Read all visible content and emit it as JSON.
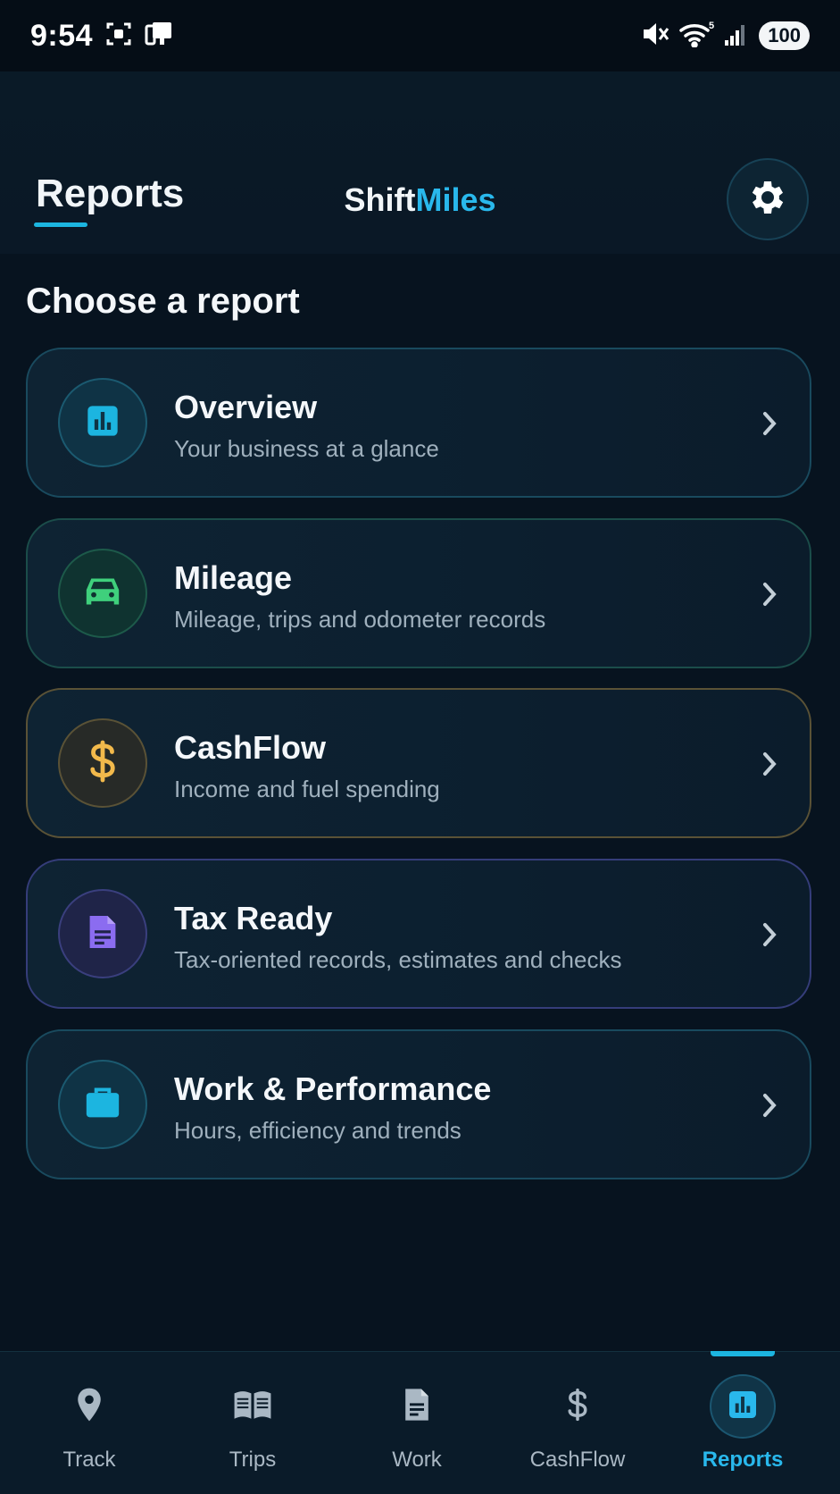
{
  "status_bar": {
    "time": "9:54",
    "battery": "100",
    "icons": [
      "screenshot-icon",
      "cast-icon",
      "mute-icon",
      "wifi-icon",
      "signal-icon"
    ]
  },
  "header": {
    "title": "Reports",
    "brand_part1": "Shift",
    "brand_part2": "Miles",
    "settings_icon": "gear-icon"
  },
  "main": {
    "section_title": "Choose a report",
    "reports": [
      {
        "title": "Overview",
        "subtitle": "Your business at a glance",
        "icon": "bar-chart-icon",
        "accent": "#1cb5e0"
      },
      {
        "title": "Mileage",
        "subtitle": "Mileage, trips and odometer records",
        "icon": "car-icon",
        "accent": "#3fd07c"
      },
      {
        "title": "CashFlow",
        "subtitle": "Income and fuel spending",
        "icon": "dollar-icon",
        "accent": "#f2b94b"
      },
      {
        "title": "Tax Ready",
        "subtitle": "Tax-oriented records, estimates and checks",
        "icon": "document-icon",
        "accent": "#8b6cf0"
      },
      {
        "title": "Work & Performance",
        "subtitle": "Hours, efficiency and trends",
        "icon": "briefcase-icon",
        "accent": "#1cb5e0"
      }
    ]
  },
  "bottom_nav": {
    "items": [
      {
        "label": "Track",
        "icon": "location-pin-icon",
        "active": false
      },
      {
        "label": "Trips",
        "icon": "book-icon",
        "active": false
      },
      {
        "label": "Work",
        "icon": "document-icon",
        "active": false
      },
      {
        "label": "CashFlow",
        "icon": "dollar-icon",
        "active": false
      },
      {
        "label": "Reports",
        "icon": "bar-chart-icon",
        "active": true
      }
    ]
  },
  "colors": {
    "background": "#07131f",
    "accent": "#29b8ec",
    "mileage": "#3fd07c",
    "cashflow": "#f2b94b",
    "tax": "#8b6cf0"
  }
}
